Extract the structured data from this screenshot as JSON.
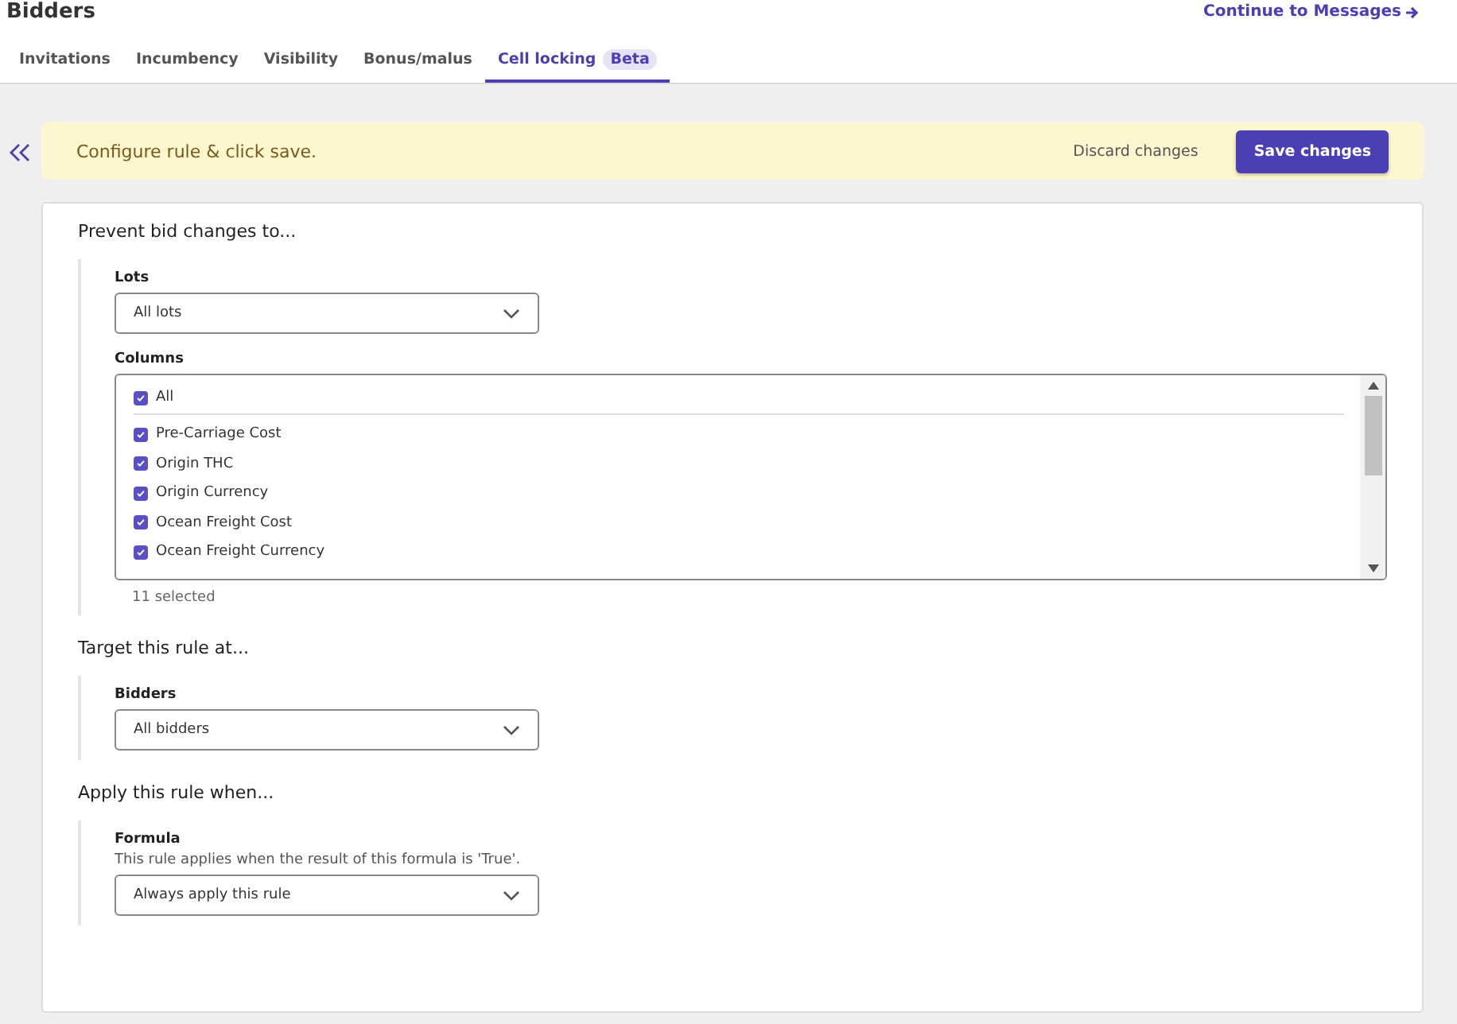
{
  "header": {
    "title": "Bidders",
    "continue_link": "Continue to Messages"
  },
  "tabs": [
    {
      "label": "Invitations",
      "selected": false
    },
    {
      "label": "Incumbency",
      "selected": false
    },
    {
      "label": "Visibility",
      "selected": false
    },
    {
      "label": "Bonus/malus",
      "selected": false
    },
    {
      "label": "Cell locking",
      "badge": "Beta",
      "selected": true
    }
  ],
  "banner": {
    "message": "Configure rule & click save.",
    "discard": "Discard changes",
    "save": "Save changes"
  },
  "sections": [
    {
      "title": "Prevent bid changes to...",
      "fields": [
        {
          "kind": "select",
          "label": "Lots",
          "value": "All lots"
        },
        {
          "kind": "checklist",
          "label": "Columns",
          "all": {
            "label": "All",
            "checked": true
          },
          "items": [
            {
              "label": "Pre-Carriage Cost",
              "checked": true
            },
            {
              "label": "Origin THC",
              "checked": true
            },
            {
              "label": "Origin Currency",
              "checked": true
            },
            {
              "label": "Ocean Freight Cost",
              "checked": true
            },
            {
              "label": "Ocean Freight Currency",
              "checked": true
            }
          ],
          "count": "11 selected"
        }
      ]
    },
    {
      "title": "Target this rule at...",
      "fields": [
        {
          "kind": "select",
          "label": "Bidders",
          "value": "All bidders"
        }
      ]
    },
    {
      "title": "Apply this rule when...",
      "fields": [
        {
          "kind": "select",
          "label": "Formula",
          "hint": "This rule applies when the result of this formula is 'True'.",
          "value": "Always apply this rule"
        }
      ]
    }
  ]
}
